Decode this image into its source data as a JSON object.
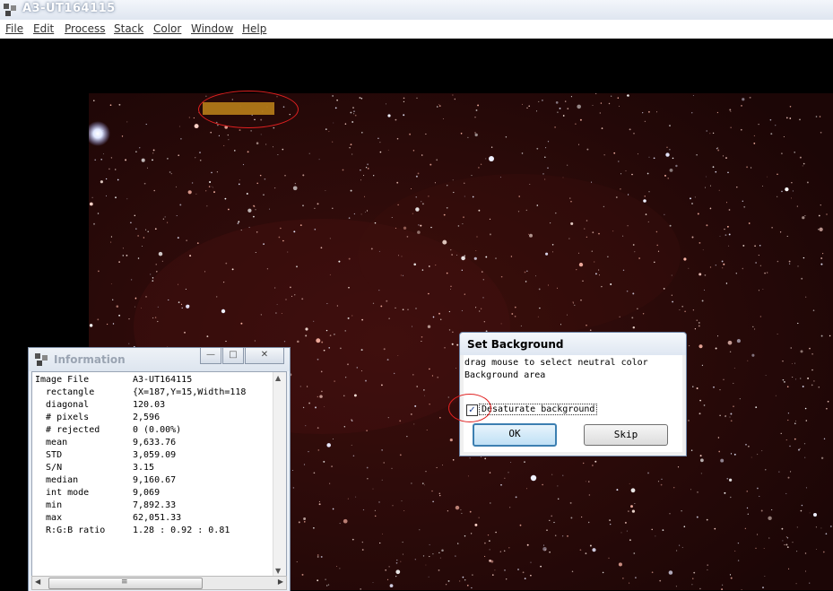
{
  "window": {
    "title": "A3-UT164115"
  },
  "menubar": {
    "items": [
      "File",
      "Edit",
      "Process",
      "Stack",
      "Color",
      "Window",
      "Help"
    ]
  },
  "info": {
    "title": "Information",
    "rows": [
      {
        "key": "Image File",
        "value": "A3-UT164115"
      },
      {
        "key": "  rectangle",
        "value": "{X=187,Y=15,Width=118"
      },
      {
        "key": "  diagonal",
        "value": "120.03"
      },
      {
        "key": "  # pixels",
        "value": "2,596"
      },
      {
        "key": "  # rejected",
        "value": "0 (0.00%)"
      },
      {
        "key": "  mean",
        "value": "9,633.76"
      },
      {
        "key": "  STD",
        "value": "3,059.09"
      },
      {
        "key": "  S/N",
        "value": "3.15"
      },
      {
        "key": "  median",
        "value": "9,160.67"
      },
      {
        "key": "  int mode",
        "value": "9,069"
      },
      {
        "key": "  min",
        "value": "7,892.33"
      },
      {
        "key": "  max",
        "value": "62,051.33"
      },
      {
        "key": "  R:G:B ratio",
        "value": "1.28 : 0.92 : 0.81"
      }
    ]
  },
  "dialog": {
    "title": "Set Background",
    "message": "drag mouse to select neutral color\nBackground area",
    "checkbox_label": "Desaturate background",
    "checkbox_checked": true,
    "ok_label": "OK",
    "skip_label": "Skip"
  },
  "colors": {
    "selection": "#b07818",
    "annotation": "#e02020"
  }
}
